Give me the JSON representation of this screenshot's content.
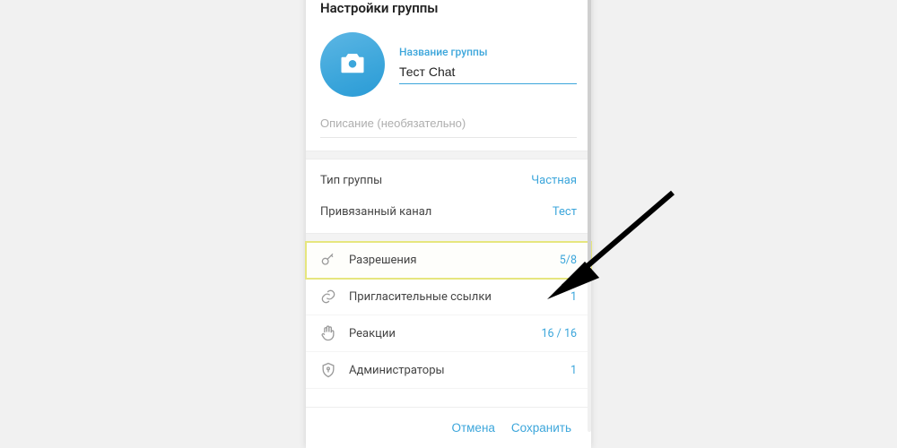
{
  "colors": {
    "accent": "#3ca6db",
    "highlight": "#e6e67e"
  },
  "header": {
    "title": "Настройки группы"
  },
  "photo": {
    "icon": "camera-icon"
  },
  "name_field": {
    "label": "Название группы",
    "value": "Тест Chat"
  },
  "description": {
    "placeholder": "Описание (необязательно)",
    "value": ""
  },
  "info_rows": [
    {
      "key": "Тип группы",
      "value": "Частная",
      "name": "group-type-row"
    },
    {
      "key": "Привязанный канал",
      "value": "Тест",
      "name": "linked-channel-row"
    }
  ],
  "menu": [
    {
      "icon": "key-icon",
      "label": "Разрешения",
      "value": "5/8",
      "name": "permissions-item",
      "highlight": true
    },
    {
      "icon": "link-icon",
      "label": "Пригласительные ссылки",
      "value": "1",
      "name": "invite-links-item",
      "highlight": false
    },
    {
      "icon": "hand-icon",
      "label": "Реакции",
      "value": "16 / 16",
      "name": "reactions-item",
      "highlight": false
    },
    {
      "icon": "shield-icon",
      "label": "Администраторы",
      "value": "1",
      "name": "administrators-item",
      "highlight": false
    }
  ],
  "footer": {
    "cancel": "Отмена",
    "save": "Сохранить"
  },
  "annotation": {
    "target": "permissions-item"
  }
}
